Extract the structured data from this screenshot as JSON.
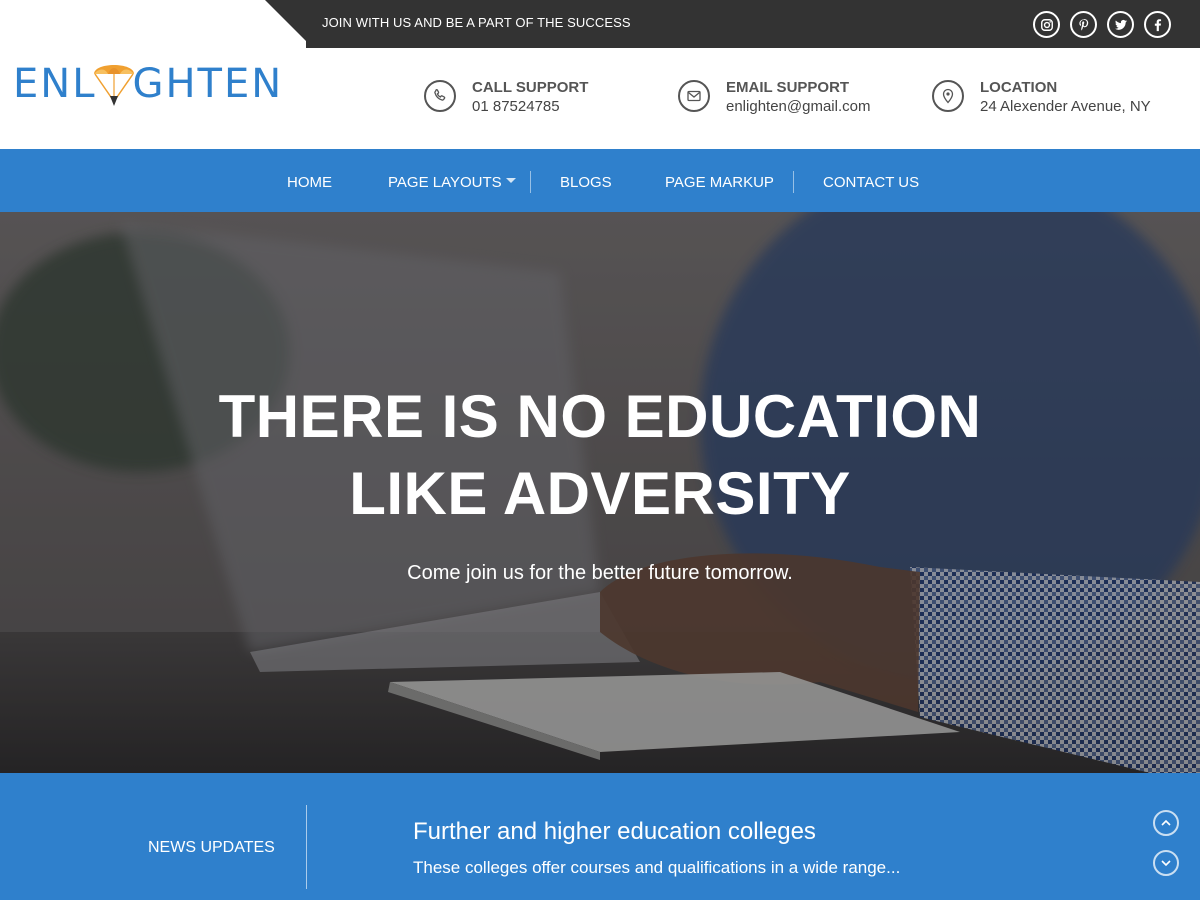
{
  "topbar": {
    "tagline": "JOIN WITH US AND BE A PART OF THE SUCCESS",
    "social": [
      {
        "icon": "instagram-icon"
      },
      {
        "icon": "pinterest-icon"
      },
      {
        "icon": "twitter-icon"
      },
      {
        "icon": "facebook-icon"
      }
    ]
  },
  "header": {
    "logo_text_left": "ENL",
    "logo_text_right": "GHTEN",
    "contacts": [
      {
        "icon": "phone-icon",
        "title": "CALL SUPPORT",
        "value": "01 87524785"
      },
      {
        "icon": "mail-icon",
        "title": "EMAIL SUPPORT",
        "value": "enlighten@gmail.com"
      },
      {
        "icon": "location-pin-icon",
        "title": "LOCATION",
        "value": "24 Alexender Avenue, NY"
      }
    ]
  },
  "nav": {
    "items": [
      {
        "label": "HOME"
      },
      {
        "label": "PAGE LAYOUTS",
        "has_dropdown": true
      },
      {
        "label": "BLOGS"
      },
      {
        "label": "PAGE MARKUP"
      },
      {
        "label": "CONTACT US"
      }
    ]
  },
  "hero": {
    "title_line1": "THERE IS NO EDUCATION",
    "title_line2": "LIKE ADVERSITY",
    "subtitle": "Come join us for the better future tomorrow."
  },
  "news": {
    "label": "NEWS UPDATES",
    "title": "Further and higher education colleges",
    "text": "These colleges offer courses and qualifications in a wide range..."
  },
  "colors": {
    "brand_blue": "#2f80cc",
    "topbar_dark": "#333333",
    "logo_orange": "#f0a030"
  }
}
